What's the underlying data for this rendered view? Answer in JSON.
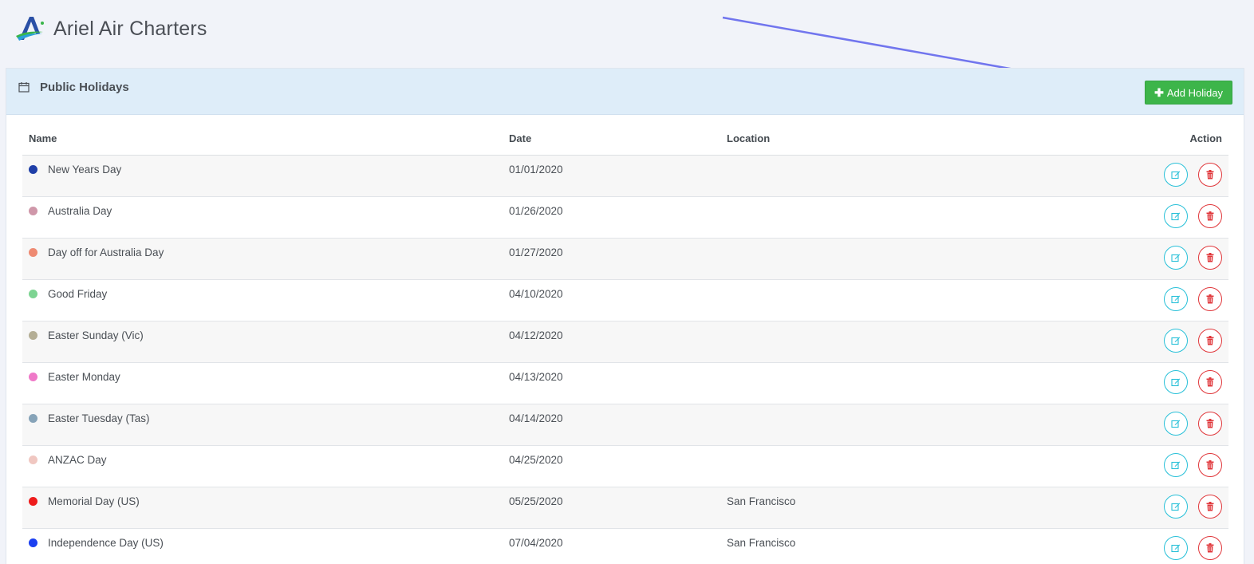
{
  "app": {
    "title": "Ariel Air Charters"
  },
  "panel": {
    "title": "Public Holidays",
    "add_button_label": "Add Holiday",
    "icon": "calendar-icon"
  },
  "table": {
    "columns": {
      "name": "Name",
      "date": "Date",
      "location": "Location",
      "action": "Action"
    },
    "rows": [
      {
        "name": "New Years Day",
        "date": "01/01/2020",
        "location": "",
        "color": "#1f3fa8"
      },
      {
        "name": "Australia Day",
        "date": "01/26/2020",
        "location": "",
        "color": "#cf97a9"
      },
      {
        "name": "Day off for Australia Day",
        "date": "01/27/2020",
        "location": "",
        "color": "#ee8a72"
      },
      {
        "name": "Good Friday",
        "date": "04/10/2020",
        "location": "",
        "color": "#7dd492"
      },
      {
        "name": "Easter Sunday (Vic)",
        "date": "04/12/2020",
        "location": "",
        "color": "#b4ae95"
      },
      {
        "name": "Easter Monday",
        "date": "04/13/2020",
        "location": "",
        "color": "#ef79c8"
      },
      {
        "name": "Easter Tuesday (Tas)",
        "date": "04/14/2020",
        "location": "",
        "color": "#86a3b8"
      },
      {
        "name": "ANZAC Day",
        "date": "04/25/2020",
        "location": "",
        "color": "#f0c7c1"
      },
      {
        "name": "Memorial Day (US)",
        "date": "05/25/2020",
        "location": "San Francisco",
        "color": "#ee1c1c"
      },
      {
        "name": "Independence Day (US)",
        "date": "07/04/2020",
        "location": "San Francisco",
        "color": "#1b3ff0"
      }
    ]
  },
  "colors": {
    "accent_green": "#3db54a",
    "edit_cyan": "#27c0d8",
    "delete_red": "#e0363a",
    "arrow": "#7175ee"
  }
}
